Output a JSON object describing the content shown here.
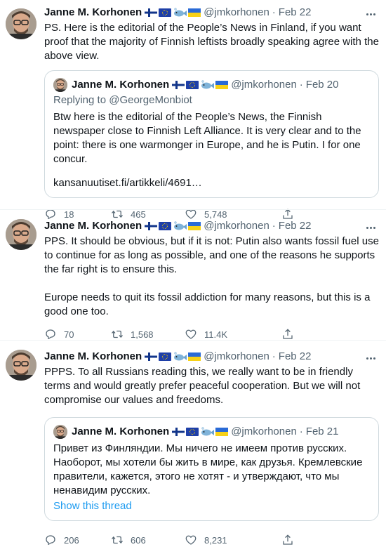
{
  "tweets": [
    {
      "name": "Janne M. Korhonen",
      "handle": "@jmkorhonen",
      "date": "Feb 22",
      "text": "PS. Here is the editorial of the People’s News in Finland, if you want proof that the majority of Finnish leftists broadly speaking agree with the above view.",
      "quote": {
        "name": "Janne M. Korhonen",
        "handle": "@jmkorhonen",
        "date": "Feb 20",
        "replying_label": "Replying to",
        "replying_handle": "@GeorgeMonbiot",
        "text": "Btw here is the editorial of the People’s News, the Finnish newspaper close to Finnish Left Alliance. It is very clear and to the point: there is one warmonger in Europe, and he is Putin. I for one concur.",
        "link": "kansanuutiset.fi/artikkeli/4691…"
      },
      "replies": "18",
      "retweets": "465",
      "likes": "5,748"
    },
    {
      "name": "Janne M. Korhonen",
      "handle": "@jmkorhonen",
      "date": "Feb 22",
      "text": "PPS. It should be obvious, but if it is not: Putin also wants fossil fuel use to continue for as long as possible, and one of the reasons he supports the far right is to ensure this.\n\nEurope needs to quit its fossil addiction for many reasons, but this is a good one too.",
      "replies": "70",
      "retweets": "1,568",
      "likes": "11.4K"
    },
    {
      "name": "Janne M. Korhonen",
      "handle": "@jmkorhonen",
      "date": "Feb 22",
      "text": "PPPS. To all Russians reading this, we really want to be in friendly terms and would greatly prefer peaceful cooperation. But we will not compromise our values and freedoms.",
      "quote": {
        "name": "Janne M. Korhonen",
        "handle": "@jmkorhonen",
        "date": "Feb 21",
        "text": "Привет из Финляндии. Мы ничего не имеем против русских. Наоборот, мы хотели бы жить в мире, как друзья. Кремлевские правители, кажется, этого не хотят - и утверждают, что мы ненавидим русских.",
        "show_thread": "Show this thread"
      },
      "replies": "206",
      "retweets": "606",
      "likes": "8,231"
    }
  ],
  "icons": {
    "flags": [
      "finland-flag-icon",
      "eu-flag-icon",
      "fish-icon",
      "ukraine-flag-icon"
    ],
    "actions": [
      "reply-icon",
      "retweet-icon",
      "like-icon",
      "share-icon"
    ]
  },
  "colors": {
    "text": "#0f1419",
    "secondary": "#536471",
    "link": "#1d9bf0",
    "border": "#cfd9de"
  }
}
